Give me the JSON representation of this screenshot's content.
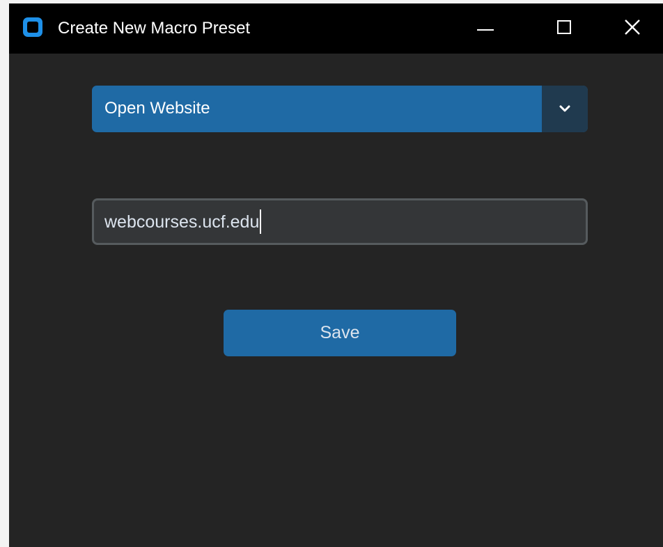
{
  "window": {
    "title": "Create New Macro Preset",
    "icon": "app-icon"
  },
  "titlebar_buttons": {
    "minimize_icon": "minimize-icon",
    "maximize_icon": "maximize-icon",
    "close_icon": "close-icon"
  },
  "action_select": {
    "selected_value": "Open Website",
    "icon": "chevron-down-icon"
  },
  "url_input": {
    "value": "webcourses.ucf.edu",
    "has_caret": true
  },
  "save_button": {
    "label": "Save"
  },
  "colors": {
    "window_background": "#242424",
    "titlebar": "#000000",
    "accent": "#1f6aa5",
    "dropdown_arrow_area": "#203a4f",
    "input_background": "#343638",
    "input_border": "#565b5e",
    "text_primary": "#ffffff",
    "text_secondary": "#dce4ee"
  }
}
